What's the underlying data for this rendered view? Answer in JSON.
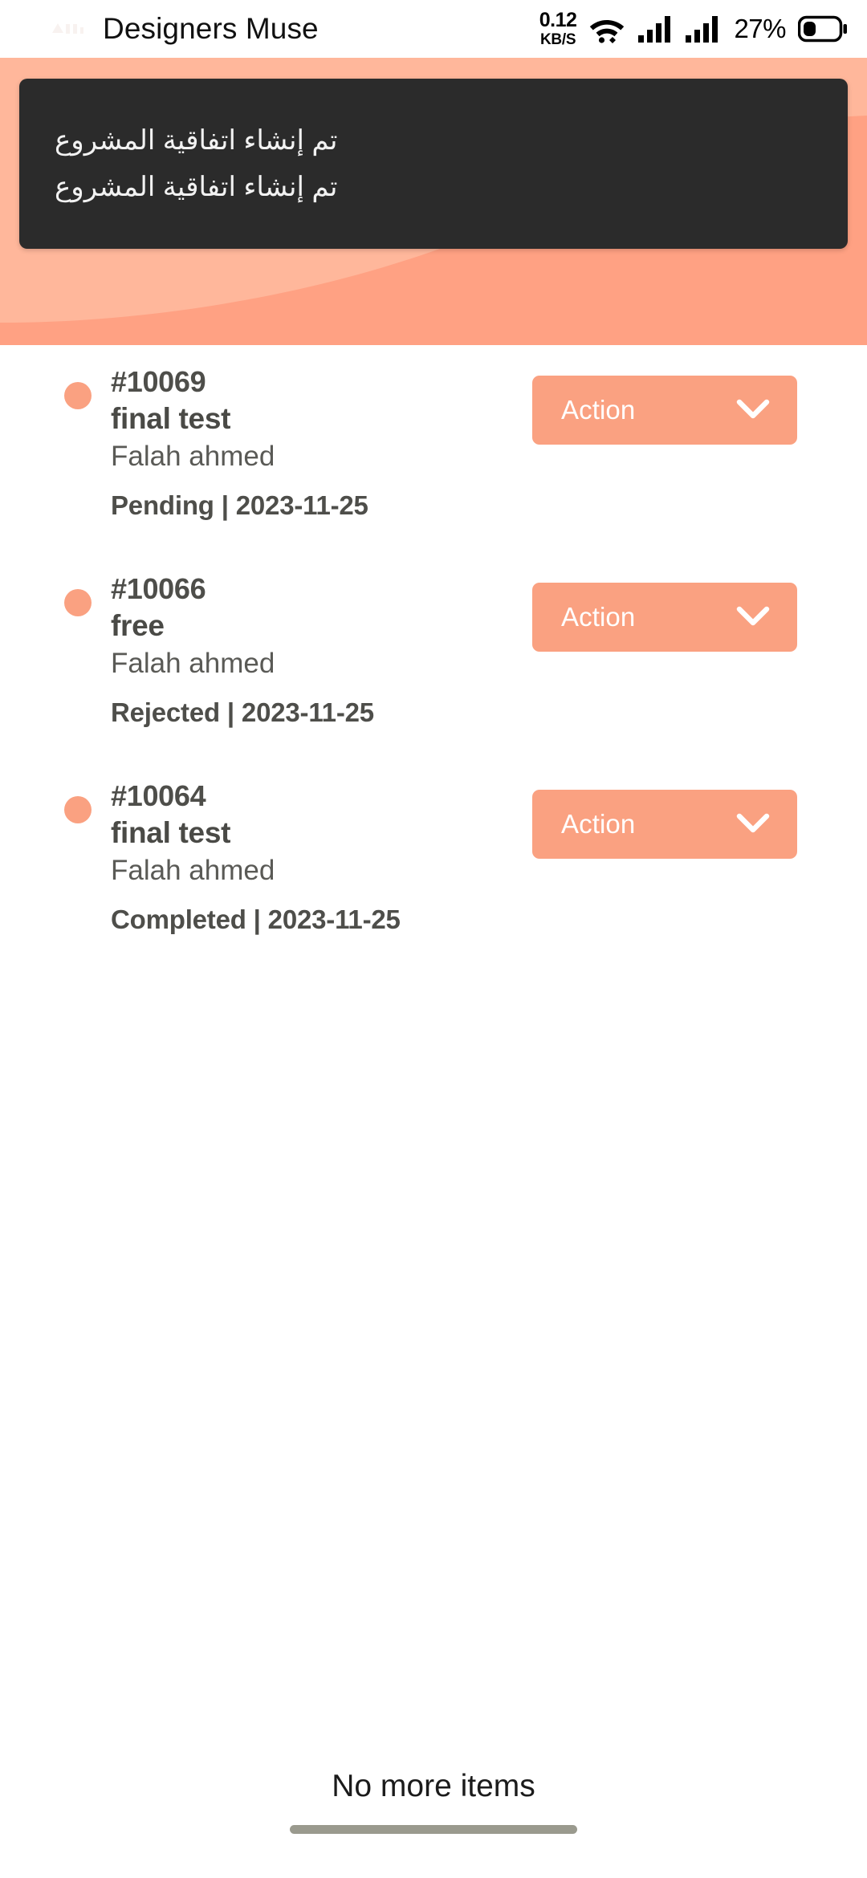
{
  "statusbar": {
    "app_title": "Designers Muse",
    "logo_icon": "app-logo-icon",
    "network_speed_value": "0.12",
    "network_speed_unit": "KB/S",
    "wifi_icon": "wifi-icon",
    "signal1_icon": "signal-bars-icon",
    "signal2_icon": "signal-bars-icon",
    "battery_percent": "27%",
    "battery_icon": "battery-icon"
  },
  "header": {
    "background_color": "#ffa183",
    "wave_color": "#ffb79b",
    "toast": {
      "background_color": "#2b2b2b",
      "lines": [
        "تم إنشاء اتفاقية المشروع",
        "تم إنشاء اتفاقية المشروع"
      ]
    }
  },
  "list": {
    "accent_color": "#faa181",
    "action_label": "Action",
    "chevron_icon": "chevron-down-icon",
    "dot_icon": "status-dot-icon",
    "items": [
      {
        "id": "#10069",
        "title": "final test",
        "person": "Falah ahmed",
        "meta": "Pending | 2023-11-25",
        "status": "Pending",
        "date": "2023-11-25"
      },
      {
        "id": "#10066",
        "title": "free",
        "person": "Falah ahmed",
        "meta": "Rejected | 2023-11-25",
        "status": "Rejected",
        "date": "2023-11-25"
      },
      {
        "id": "#10064",
        "title": "final test",
        "person": "Falah ahmed",
        "meta": "Completed | 2023-11-25",
        "status": "Completed",
        "date": "2023-11-25"
      }
    ]
  },
  "footer": {
    "no_more_text": "No more items",
    "home_indicator": "home-indicator"
  }
}
